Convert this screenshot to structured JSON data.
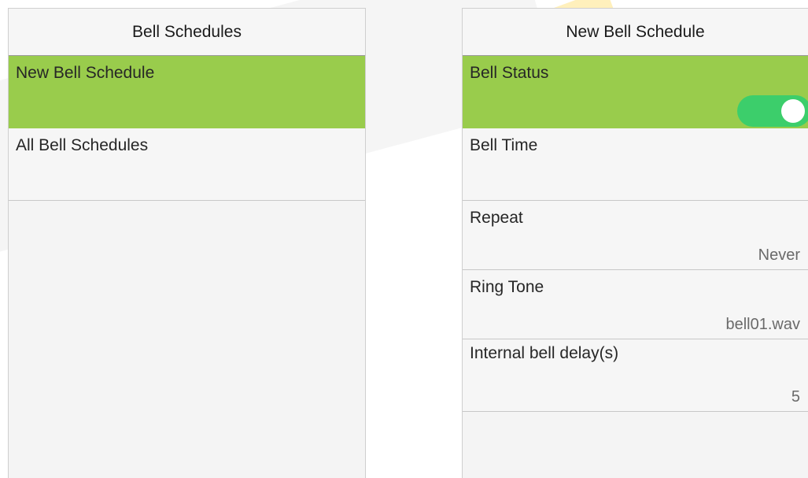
{
  "left_panel": {
    "title": "Bell Schedules",
    "items": [
      {
        "label": "New Bell Schedule",
        "selected": true
      },
      {
        "label": "All Bell Schedules",
        "selected": false
      }
    ]
  },
  "right_panel": {
    "title": "New Bell Schedule",
    "items": [
      {
        "label": "Bell Status",
        "value": "",
        "toggle_on": true
      },
      {
        "label": "Bell Time",
        "value": ""
      },
      {
        "label": "Repeat",
        "value": "Never"
      },
      {
        "label": "Ring Tone",
        "value": "bell01.wav"
      },
      {
        "label": "Internal bell delay(s)",
        "value": "5"
      }
    ]
  },
  "colors": {
    "selected_row": "#99cc4c",
    "toggle_on": "#3cce6b",
    "panel_bg": "#f4f4f4"
  }
}
